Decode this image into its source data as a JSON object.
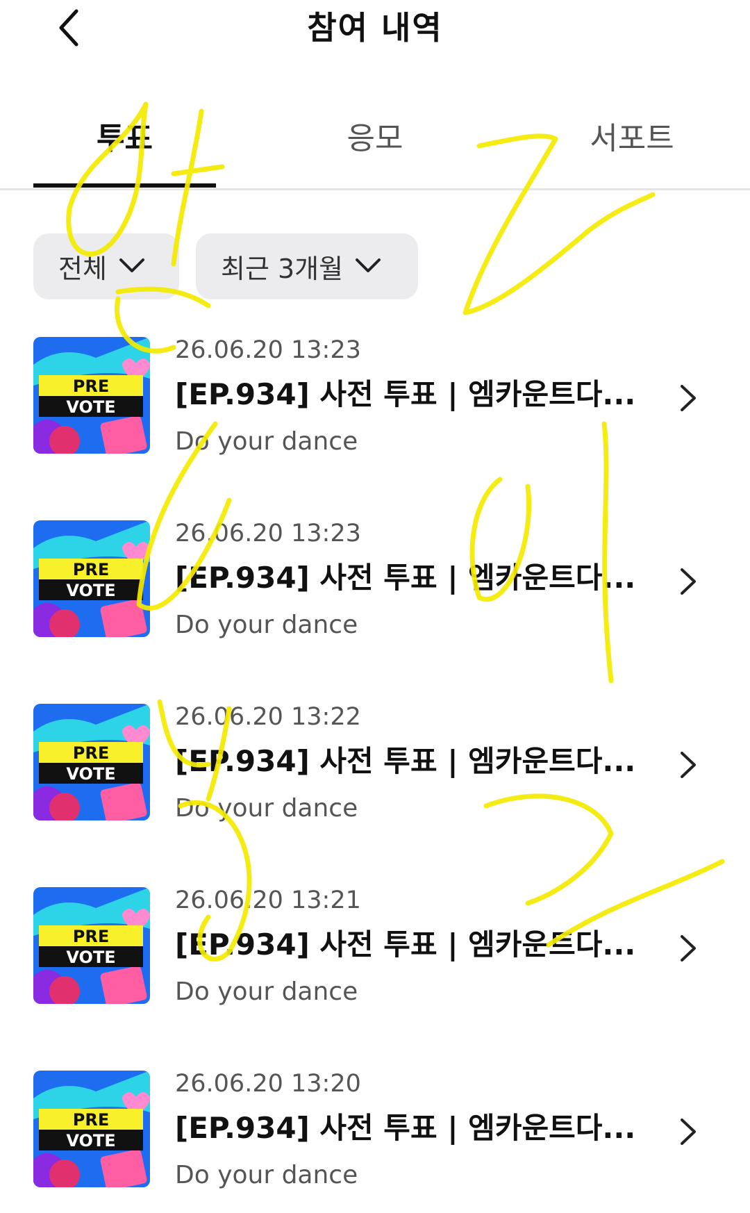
{
  "header": {
    "title": "참여 내역",
    "back_icon": "chevron-left-icon"
  },
  "tabs": [
    {
      "label": "투표",
      "active": true
    },
    {
      "label": "응모",
      "active": false
    },
    {
      "label": "서포트",
      "active": false
    }
  ],
  "filters": [
    {
      "label": "전체",
      "icon": "chevron-down-icon"
    },
    {
      "label": "최근 3개월",
      "icon": "chevron-down-icon"
    }
  ],
  "items": [
    {
      "date": "26.06.20 13:23",
      "title": "[EP.934] 사전 투표 | 엠카운트다...",
      "subtitle": "Do your dance",
      "thumb_top": "PRE",
      "thumb_bottom": "VOTE"
    },
    {
      "date": "26.06.20 13:23",
      "title": "[EP.934] 사전 투표 | 엠카운트다...",
      "subtitle": "Do your dance",
      "thumb_top": "PRE",
      "thumb_bottom": "VOTE"
    },
    {
      "date": "26.06.20 13:22",
      "title": "[EP.934] 사전 투표 | 엠카운트다...",
      "subtitle": "Do your dance",
      "thumb_top": "PRE",
      "thumb_bottom": "VOTE"
    },
    {
      "date": "26.06.20 13:21",
      "title": "[EP.934] 사전 투표 | 엠카운트다...",
      "subtitle": "Do your dance",
      "thumb_top": "PRE",
      "thumb_bottom": "VOTE"
    },
    {
      "date": "26.06.20 13:20",
      "title": "[EP.934] 사전 투표 | 엠카운트다...",
      "subtitle": "Do your dance",
      "thumb_top": "PRE",
      "thumb_bottom": "VOTE"
    }
  ],
  "colors": {
    "accent": "#111111",
    "filter_bg": "#ececef",
    "scribble": "#f4ea00",
    "thumb_bg": "#1e6cf0",
    "thumb_band": "#f7f02a"
  }
}
